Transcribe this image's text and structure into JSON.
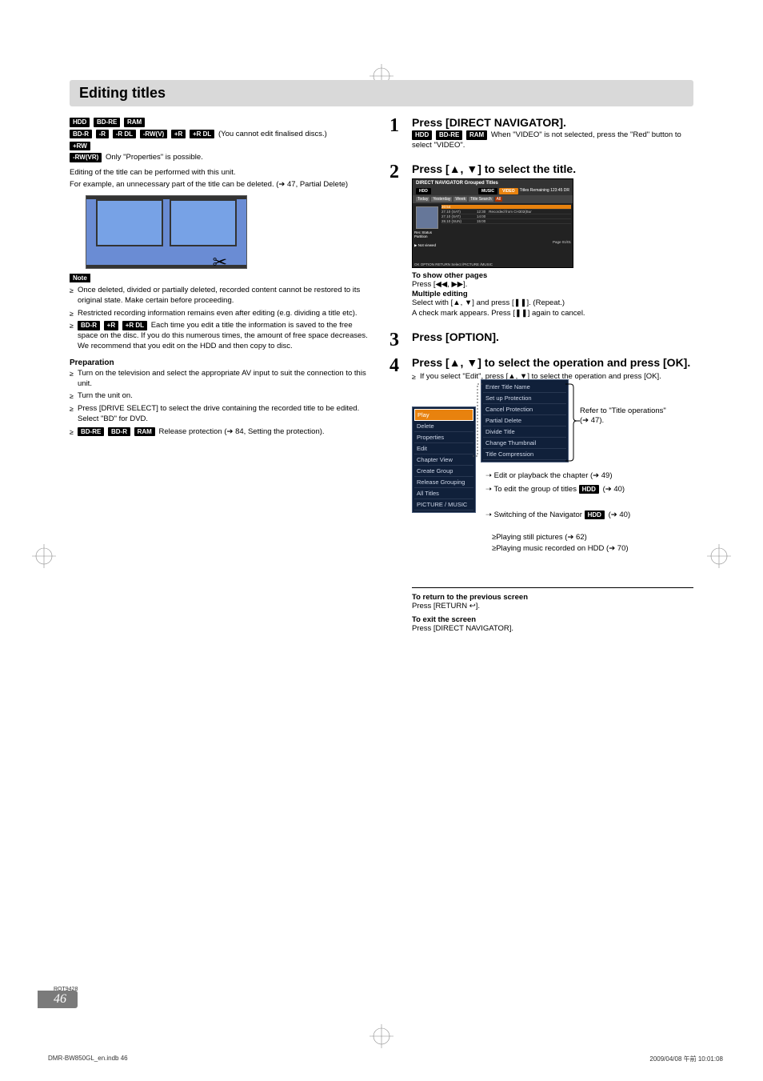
{
  "page_title": "Editing titles",
  "tags_row1": [
    "HDD",
    "BD-RE",
    "RAM"
  ],
  "tags_row2": [
    "BD-R",
    "-R",
    "-R DL",
    "-RW(V)",
    "+R",
    "+R DL"
  ],
  "row2_note": " (You cannot edit finalised discs.)",
  "tags_row3": [
    "+RW"
  ],
  "tags_row4": [
    "-RW(VR)"
  ],
  "row4_note": " Only \"Properties\" is possible.",
  "intro1": "Editing of the title can be performed with this unit.",
  "intro2": "For example, an unnecessary part of the title can be deleted. (➔ 47, Partial Delete)",
  "note_label": "Note",
  "note_bullets_a": "Once deleted, divided or partially deleted, recorded content cannot be restored to its original state. Make certain before proceeding.",
  "note_bullets_b": "Restricted recording information remains even after editing (e.g. dividing a title etc).",
  "note_bullets_cpre_tags": [
    "BD-R",
    "+R",
    "+R DL"
  ],
  "note_bullets_c": " Each time you edit a title the information is saved to the free space on the disc. If you do this numerous times, the amount of free space decreases.",
  "note_bullets_c2": "We recommend that you edit on the HDD and then copy to disc.",
  "prep_head": "Preparation",
  "prep_bullets_a": "Turn on the television and select the appropriate AV input to suit the connection to this unit.",
  "prep_bullets_b": "Turn the unit on.",
  "prep_bullets_c": "Press [DRIVE SELECT] to select the drive containing the recorded title to be edited. Select \"BD\" for DVD.",
  "prep_bullets_d_tags": [
    "BD-RE",
    "BD-R",
    "RAM"
  ],
  "prep_bullets_d": " Release protection (➔ 84, Setting the protection).",
  "steps": {
    "s1": {
      "num": "1",
      "head": "Press [DIRECT NAVIGATOR].",
      "tags": [
        "HDD",
        "BD-RE",
        "RAM"
      ],
      "text": " When \"VIDEO\" is not selected, press the \"Red\" button to select \"VIDEO\"."
    },
    "s2": {
      "num": "2",
      "head": "Press [▲, ▼] to select the title.",
      "show_head": "To show other pages",
      "show_text": "Press [◀◀, ▶▶].",
      "multi_head": "Multiple editing",
      "multi_text": "Select with [▲, ▼] and press [❚❚]. (Repeat.)",
      "multi_text2": "A check mark appears. Press [❚❚] again to cancel."
    },
    "s3": {
      "num": "3",
      "head": "Press [OPTION]."
    },
    "s4": {
      "num": "4",
      "head": "Press [▲, ▼] to select the operation and press [OK].",
      "sub": "If you select \"Edit\", press [▲, ▼] to select the operation and press [OK]."
    }
  },
  "nav": {
    "title_top": "DIRECT NAVIGATOR  Grouped Titles",
    "drive": "HDD",
    "remain": "Titles Remaining 123:45 DR",
    "tabs": [
      "VIDEO",
      "MUSIC"
    ],
    "subtabs": [
      "Today",
      "Yesterday",
      "Week",
      "Title Search",
      "All"
    ],
    "rows": [
      {
        "date": "20:54",
        "chan": "",
        "time": "",
        "name": ""
      },
      {
        "date": "27.10 (SAT)",
        "chan": "",
        "time": "12:30",
        "name": "Recorded from CH302(Bur"
      },
      {
        "date": "27.10 (SAT)",
        "chan": "",
        "time": "14:00",
        "name": ""
      },
      {
        "date": "28.10 (SUN)",
        "chan": "",
        "time": "15:00",
        "name": ""
      }
    ],
    "recstatus": "Rec Status",
    "partition": "Partition",
    "notviewed": "Not viewed",
    "page": "Page 01/01",
    "footer": "OK   OPTION   RETURN   Select   /PICTURE   /MUSIC"
  },
  "options": {
    "left": [
      "Play",
      "Delete",
      "Properties",
      "Edit",
      "Chapter View",
      "Create Group",
      "Release Grouping",
      "All Titles",
      "PICTURE / MUSIC"
    ],
    "right": [
      "Enter Title Name",
      "Set up Protection",
      "Cancel Protection",
      "Partial Delete",
      "Divide Title",
      "Change Thumbnail",
      "Title Compression"
    ]
  },
  "annots": {
    "refer": "Refer to \"Title operations\" (➔ 47).",
    "chapter": "Edit or playback the chapter (➔ 49)",
    "group_pre": "To edit the group of titles ",
    "group_tag": "HDD",
    "group_post": " (➔ 40)",
    "switch_pre": "Switching of the Navigator ",
    "switch_tag": "HDD",
    "switch_post": " (➔ 40)",
    "pic": "Playing still pictures (➔ 62)",
    "music": "Playing music recorded on HDD (➔ 70)"
  },
  "footer_block": {
    "ret_head": "To return to the previous screen",
    "ret_text": "Press [RETURN ↩].",
    "exit_head": "To exit the screen",
    "exit_text": "Press [DIRECT NAVIGATOR]."
  },
  "rqt": "RQT9428",
  "page_num": "46",
  "print_left": "DMR-BW850GL_en.indb   46",
  "print_right": "2009/04/08   午前 10:01:08"
}
